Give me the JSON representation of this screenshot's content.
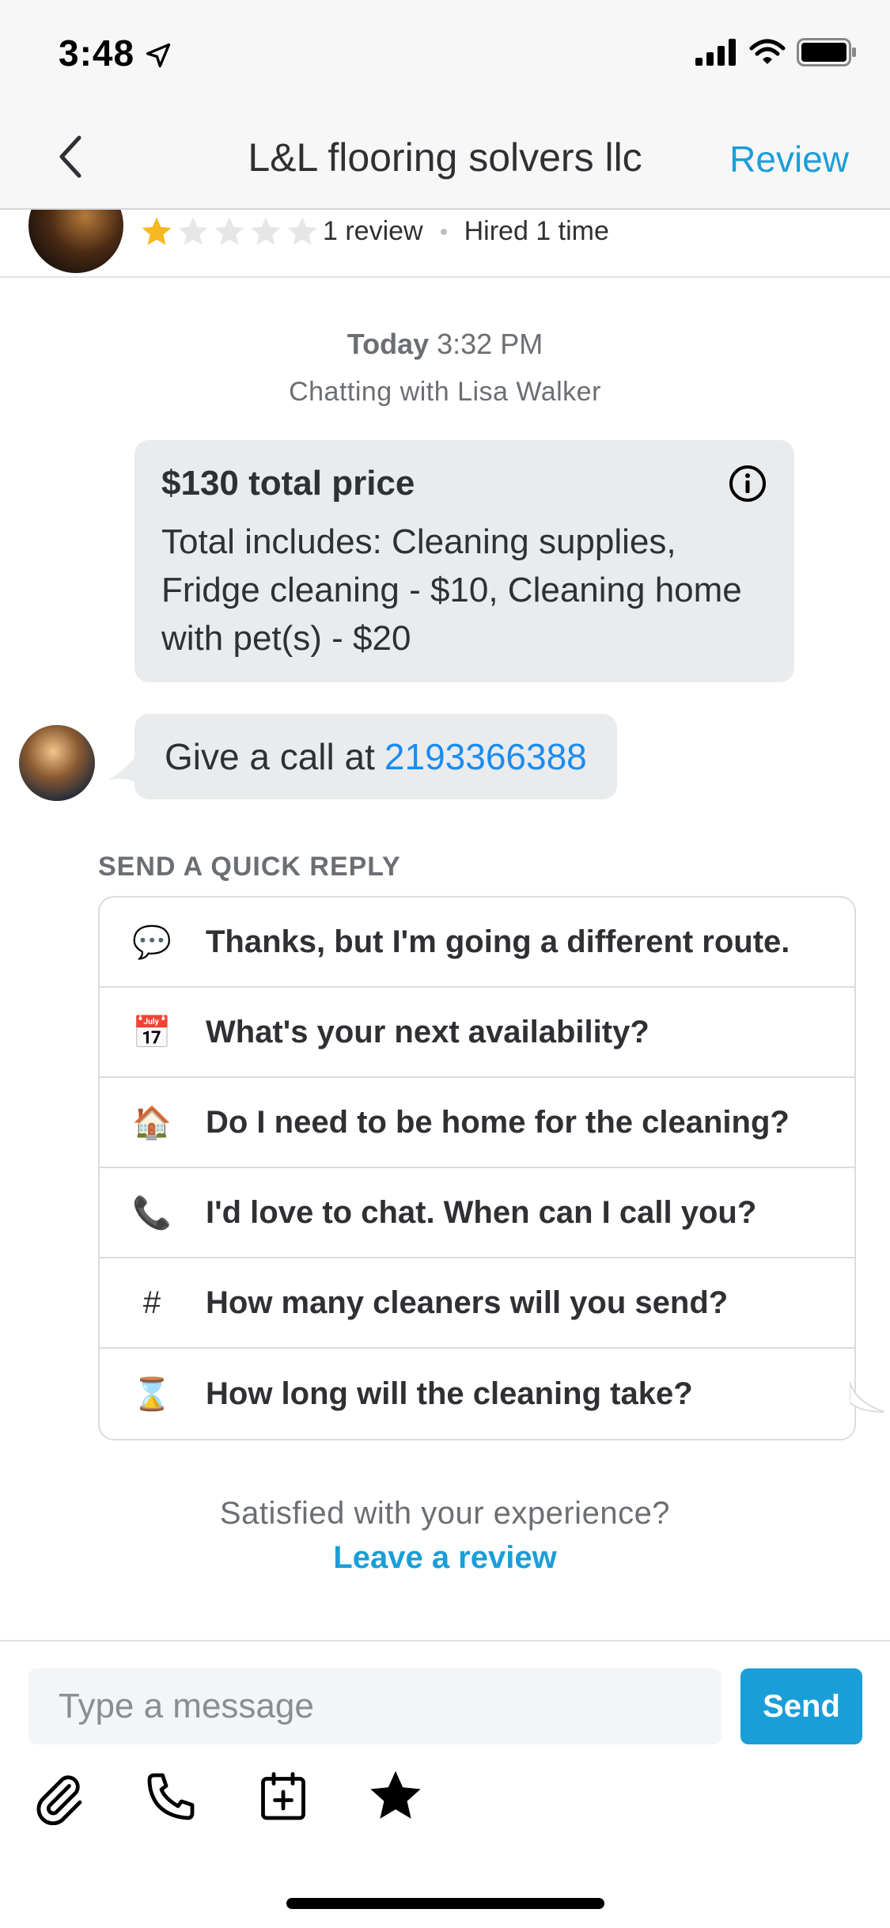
{
  "status_bar": {
    "time": "3:48"
  },
  "nav": {
    "title": "L&L flooring solvers llc",
    "review_label": "Review"
  },
  "profile": {
    "rating_filled": 1,
    "rating_total": 5,
    "reviews_text": "1 review",
    "hired_text": "Hired 1 time"
  },
  "chat": {
    "date_bold": "Today",
    "date_time": "3:32 PM",
    "chatting_with": "Chatting with Lisa Walker"
  },
  "price_card": {
    "title": "$130 total price",
    "body": "Total includes: Cleaning supplies, Fridge cleaning - $10, Cleaning home with pet(s) - $20"
  },
  "message": {
    "prefix": "Give a call at",
    "phone": "2193366388"
  },
  "quick_reply": {
    "heading": "SEND A QUICK REPLY",
    "items": [
      {
        "icon": "speech-bubble-icon",
        "glyph": "💬",
        "text": "Thanks, but I'm going a different route."
      },
      {
        "icon": "calendar-icon",
        "glyph": "📅",
        "text": "What's your next availability?"
      },
      {
        "icon": "house-icon",
        "glyph": "🏠",
        "text": "Do I need to be home for the cleaning?"
      },
      {
        "icon": "telephone-icon",
        "glyph": "📞",
        "text": "I'd love to chat. When can I call you?"
      },
      {
        "icon": "hash-icon",
        "glyph": "#",
        "text": "How many cleaners will you send?"
      },
      {
        "icon": "hourglass-icon",
        "glyph": "⌛",
        "text": "How long will the cleaning take?"
      }
    ]
  },
  "review_prompt": {
    "question": "Satisfied with your experience?",
    "link": "Leave a review"
  },
  "composer": {
    "placeholder": "Type a message",
    "send_label": "Send"
  },
  "colors": {
    "accent": "#1a9ed8",
    "link": "#1a8cf0",
    "star": "#f5b820",
    "bubble": "#e9ebed"
  }
}
